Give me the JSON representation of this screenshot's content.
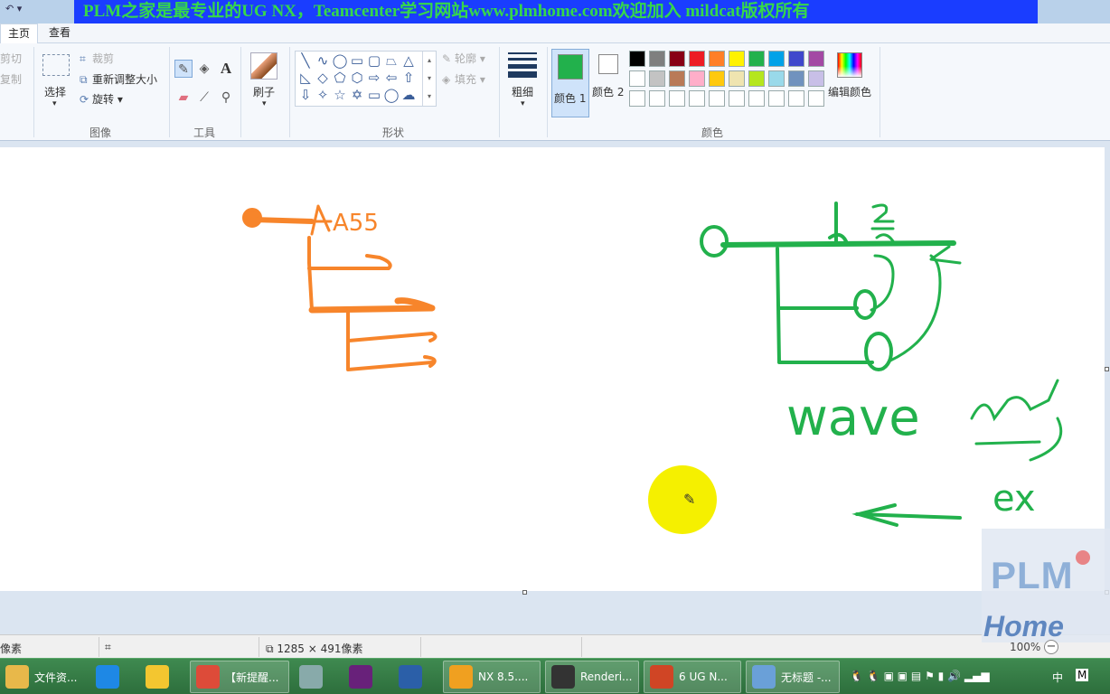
{
  "window": {
    "banner_text": "PLM之家是最专业的UG NX，Teamcenter学习网站www.plmhome.com欢迎加入 mildcat版权所有",
    "qat_icons": [
      "undo-icon",
      "qat-dropdown-icon"
    ]
  },
  "tabs": [
    {
      "label": "主页",
      "active": true
    },
    {
      "label": "查看",
      "active": false
    }
  ],
  "ribbon": {
    "clipboard": {
      "cut": "剪切",
      "copy": "复制"
    },
    "image": {
      "select": "选择",
      "crop": "裁剪",
      "resize": "重新调整大小",
      "rotate": "旋转",
      "group": "图像"
    },
    "tools": {
      "group": "工具",
      "text_icon": "A"
    },
    "brush": {
      "label": "刷子"
    },
    "shapes": {
      "outline": "轮廓",
      "fill": "填充",
      "group": "形状"
    },
    "size": {
      "label": "粗细"
    },
    "colors": {
      "color1": "颜色 1",
      "color2": "颜色 2",
      "edit_colors": "编辑颜色",
      "group": "颜色",
      "selected_color1": "#22b14c",
      "selected_color2": "#ffffff",
      "palette_row1": [
        "#000000",
        "#7f7f7f",
        "#880015",
        "#ed1c24",
        "#ff7f27",
        "#fff200",
        "#22b14c",
        "#00a2e8",
        "#3f48cc",
        "#a349a4"
      ],
      "palette_row2": [
        "#ffffff",
        "#c3c3c3",
        "#b97a57",
        "#ffaec9",
        "#ffc90e",
        "#efe4b0",
        "#b5e61d",
        "#99d9ea",
        "#7092be",
        "#c8bfe7"
      ],
      "palette_row3": [
        "#ffffff",
        "#ffffff",
        "#ffffff",
        "#ffffff",
        "#ffffff",
        "#ffffff",
        "#ffffff",
        "#ffffff",
        "#ffffff",
        "#ffffff"
      ]
    }
  },
  "canvas": {
    "handwriting_a": "A55",
    "handwriting_b": "wave",
    "handwriting_c": "ex",
    "drawing_colors": {
      "orange": "#f7852b",
      "green": "#22b14c",
      "cursor_highlight": "#f5f000"
    }
  },
  "status": {
    "cursor_pos": "像素",
    "canvas_size": "1285 × 491像素",
    "zoom": "100%"
  },
  "watermark": {
    "line1": "PLM",
    "line2": "Home"
  },
  "taskbar": {
    "items": [
      {
        "label": "文件资...",
        "icon": "folder-icon",
        "color": "#e8b84a"
      },
      {
        "label": "",
        "icon": "ie-icon",
        "color": "#1e88e5"
      },
      {
        "label": "",
        "icon": "chart-app-icon",
        "color": "#f3c630"
      },
      {
        "label": "【新提醒...",
        "icon": "chrome-icon",
        "color": "#dd4b39"
      },
      {
        "label": "",
        "icon": "tool-icon",
        "color": "#8aa"
      },
      {
        "label": "",
        "icon": "visual-studio-icon",
        "color": "#68217a"
      },
      {
        "label": "",
        "icon": "infinity-icon",
        "color": "#2b5fa8"
      },
      {
        "label": "NX 8.5....",
        "icon": "nx-icon",
        "color": "#f0a020"
      },
      {
        "label": "Renderi...",
        "icon": "render-icon",
        "color": "#333"
      },
      {
        "label": "6 UG N...",
        "icon": "powerpoint-icon",
        "color": "#d04525"
      },
      {
        "label": "无标题 -...",
        "icon": "paint-icon",
        "color": "#6aa0d8"
      }
    ],
    "ime": "中",
    "ime_mode": "M"
  }
}
